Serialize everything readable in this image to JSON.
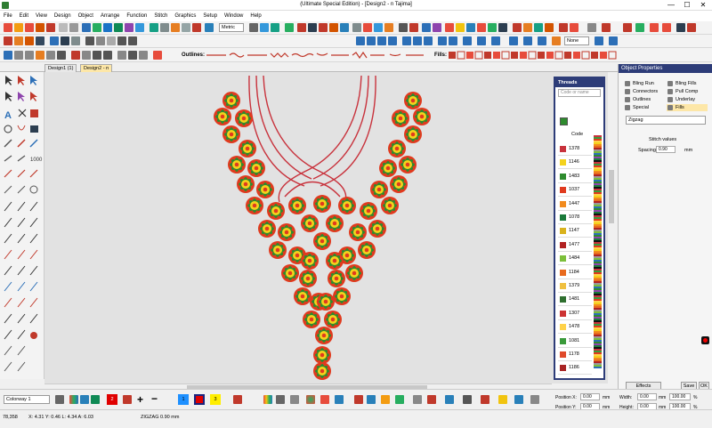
{
  "window": {
    "title": "(Ultimate Special Edition) - [Design2 - n     Tajima]",
    "minimize": "—",
    "maximize": "☐",
    "close": "✕"
  },
  "menu": [
    "File",
    "Edit",
    "View",
    "Design",
    "Object",
    "Arrange",
    "Function",
    "Stitch",
    "Graphics",
    "Setup",
    "Window",
    "Help"
  ],
  "toolbar": {
    "units": "Metric",
    "outlines_label": "Outlines:",
    "fills_label": "Fills:",
    "none_label": "None"
  },
  "tabs": [
    "Design1 (1)",
    "Design2 - n"
  ],
  "threads": {
    "title": "Threads",
    "search_placeholder": "Code or name",
    "column_header": "Code",
    "codes": [
      "1378",
      "1146",
      "1483",
      "1037",
      "1447",
      "1078",
      "1147",
      "1477",
      "1484",
      "1184",
      "1379",
      "1481",
      "1307",
      "1478",
      "1081",
      "1178",
      "1186"
    ]
  },
  "object_properties": {
    "title": "Object Properties",
    "tabs": [
      "Bling Run",
      "Bling Fills",
      "Connectors",
      "Pull Comp",
      "Outlines",
      "Underlay",
      "Special",
      "Fills"
    ],
    "stitch_type": "Zigzag",
    "stitch_values_label": "Stitch values",
    "spacing_label": "Spacing:",
    "spacing_value": "0.90",
    "spacing_unit": "mm",
    "effects_button": "Effects",
    "save_button": "Save",
    "ok_button": "OK"
  },
  "bottom": {
    "colorway": "Colorway 1",
    "color_slots": [
      "2",
      "1",
      "3"
    ],
    "position_x_label": "Position X:",
    "position_y_label": "Position Y:",
    "width_label": "Width:",
    "height_label": "Height:",
    "position_x": "0.00",
    "position_y": "0.00",
    "width": "0.00",
    "height": "0.00",
    "width_pct": "100.00",
    "height_pct": "100.00",
    "unit_mm": "mm",
    "unit_pct": "%"
  },
  "status": {
    "stitches": "78,358",
    "coords": "X: 4.31  Y: 0.46  L: 4.34  A: 6.03",
    "stitch_info": "ZIGZAG  0.90 mm"
  },
  "colors": {
    "panel_header": "#2d3c78",
    "flower_red": "#e03a1e",
    "flower_green": "#2e8b2e",
    "flower_yellow": "#f4d21c",
    "neck_line": "#c8323c"
  }
}
